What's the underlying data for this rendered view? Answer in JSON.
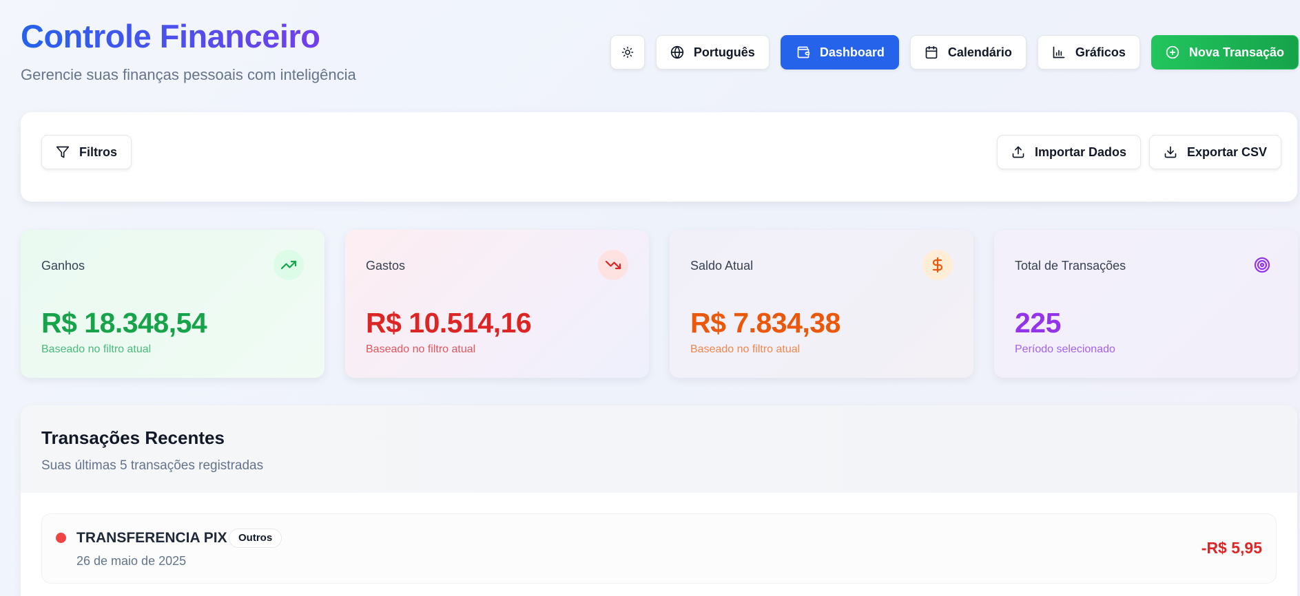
{
  "header": {
    "title": "Controle Financeiro",
    "subtitle": "Gerencie suas finanças pessoais com inteligência"
  },
  "nav": {
    "language": "Português",
    "dashboard": "Dashboard",
    "calendar": "Calendário",
    "charts": "Gráficos",
    "new_transaction": "Nova Transação"
  },
  "filters": {
    "filters_label": "Filtros",
    "import_label": "Importar Dados",
    "export_label": "Exportar CSV"
  },
  "stats": [
    {
      "label": "Ganhos",
      "value": "R$ 18.348,54",
      "note": "Baseado no filtro atual",
      "icon": "trending-up-icon",
      "color": "#16a34a"
    },
    {
      "label": "Gastos",
      "value": "R$ 10.514,16",
      "note": "Baseado no filtro atual",
      "icon": "trending-down-icon",
      "color": "#dc2626"
    },
    {
      "label": "Saldo Atual",
      "value": "R$ 7.834,38",
      "note": "Baseado no filtro atual",
      "icon": "dollar-icon",
      "color": "#ea580c"
    },
    {
      "label": "Total de Transações",
      "value": "225",
      "note": "Período selecionado",
      "icon": "target-icon",
      "color": "#9333ea"
    }
  ],
  "recent": {
    "title": "Transações Recentes",
    "subtitle": "Suas últimas 5 transações registradas",
    "items": [
      {
        "title": "TRANSFERENCIA PIX",
        "category": "Outros",
        "date": "26 de maio de 2025",
        "amount": "-R$ 5,95",
        "type_color": "#ef4444"
      }
    ]
  }
}
